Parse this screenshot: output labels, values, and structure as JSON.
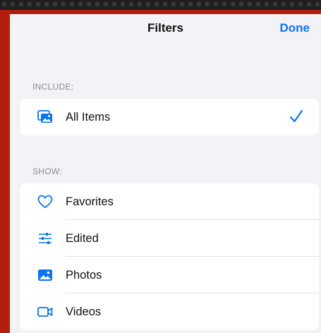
{
  "navbar": {
    "title": "Filters",
    "done_label": "Done"
  },
  "include": {
    "header": "INCLUDE:",
    "items": [
      {
        "label": "All Items",
        "icon": "photo-stack-icon",
        "selected": true
      }
    ]
  },
  "show": {
    "header": "SHOW:",
    "items": [
      {
        "label": "Favorites",
        "icon": "heart-icon"
      },
      {
        "label": "Edited",
        "icon": "sliders-icon"
      },
      {
        "label": "Photos",
        "icon": "photo-icon"
      },
      {
        "label": "Videos",
        "icon": "video-camera-icon"
      }
    ]
  },
  "colors": {
    "accent": "#0a74f2",
    "frame": "#b41e0e",
    "background": "#f2f2f7"
  }
}
